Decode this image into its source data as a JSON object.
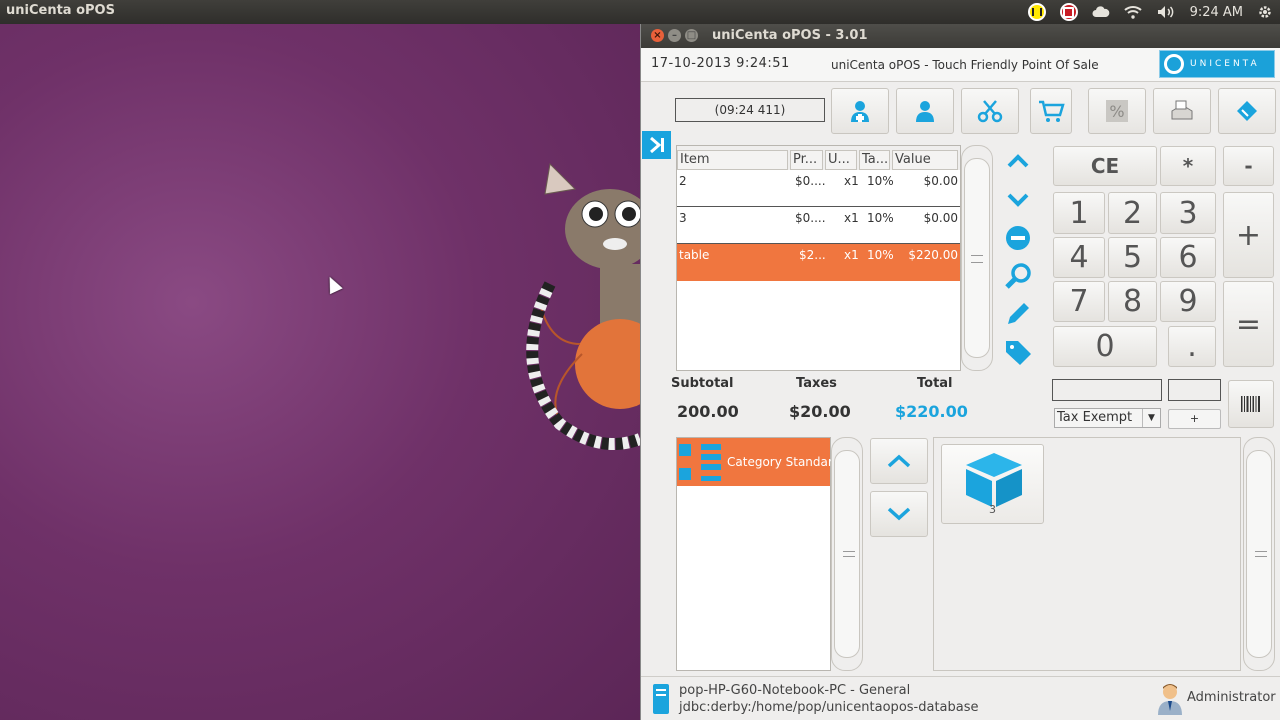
{
  "topbar": {
    "app_name": "uniCenta oPOS",
    "time": "9:24 AM"
  },
  "window": {
    "title": "uniCenta oPOS - 3.01"
  },
  "header": {
    "datetime": "17-10-2013 9:24:51",
    "tagline": "uniCenta oPOS - Touch Friendly Point Of Sale",
    "logo_text": "UNICENTA"
  },
  "ticket": {
    "id": "(09:24 411)",
    "columns": [
      "Item",
      "Pr...",
      "U...",
      "Ta...",
      "Value"
    ],
    "rows": [
      {
        "item": "2",
        "price": "$0....",
        "units": "x1",
        "tax": "10%",
        "value": "$0.00"
      },
      {
        "item": "3",
        "price": "$0....",
        "units": "x1",
        "tax": "10%",
        "value": "$0.00"
      },
      {
        "item": "table",
        "price": "$2...",
        "units": "x1",
        "tax": "10%",
        "value": "$220.00"
      }
    ]
  },
  "totals": {
    "subtotal_label": "Subtotal",
    "taxes_label": "Taxes",
    "total_label": "Total",
    "subtotal": "200.00",
    "taxes": "$20.00",
    "total": "$220.00"
  },
  "keypad": {
    "ce": "CE",
    "star": "*",
    "minus": "-",
    "plus": "+",
    "equals": "=",
    "dot": ".",
    "digits": [
      "1",
      "2",
      "3",
      "4",
      "5",
      "6",
      "7",
      "8",
      "9",
      "0"
    ]
  },
  "tax": {
    "selected": "Tax Exempt",
    "add_label": "+"
  },
  "categories": [
    {
      "label": "Category Standard"
    }
  ],
  "products": [
    {
      "label": "3"
    }
  ],
  "status": {
    "host": "pop-HP-G60-Notebook-PC - General",
    "db": "jdbc:derby:/home/pop/unicentaopos-database",
    "user": "Administrator"
  },
  "colors": {
    "accent": "#1ba4dd",
    "selection": "#f0763f"
  }
}
